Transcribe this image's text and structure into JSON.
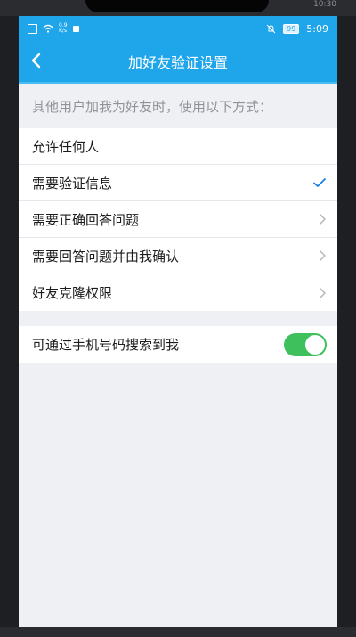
{
  "device": {
    "top_clock": "10:30"
  },
  "status_bar": {
    "net_speed_value": "0.9",
    "net_speed_unit": "K/s",
    "battery": "99",
    "time": "5:09"
  },
  "nav": {
    "title": "加好友验证设置"
  },
  "section": {
    "description": "其他用户加我为好友时，使用以下方式："
  },
  "options": [
    {
      "label": "允许任何人",
      "indicator": "none"
    },
    {
      "label": "需要验证信息",
      "indicator": "checkmark"
    },
    {
      "label": "需要正确回答问题",
      "indicator": "chevron"
    },
    {
      "label": "需要回答问题并由我确认",
      "indicator": "chevron"
    },
    {
      "label": "好友克隆权限",
      "indicator": "chevron"
    }
  ],
  "phone_search": {
    "label": "可通过手机号码搜索到我",
    "enabled": true
  },
  "colors": {
    "accent": "#1fa5ea",
    "toggle_on": "#3ec05c",
    "check": "#1a7fe3",
    "background": "#eff0f4"
  }
}
